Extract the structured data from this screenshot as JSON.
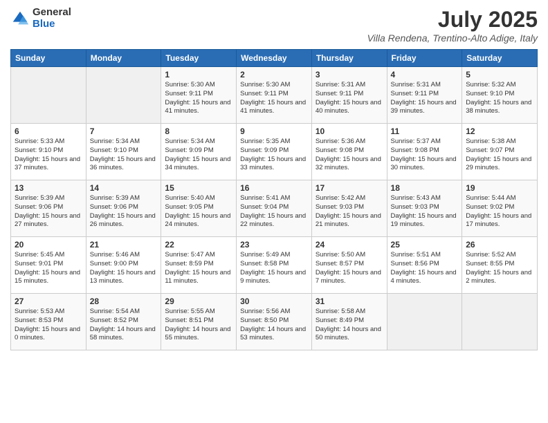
{
  "logo": {
    "general": "General",
    "blue": "Blue"
  },
  "title": {
    "month_year": "July 2025",
    "location": "Villa Rendena, Trentino-Alto Adige, Italy"
  },
  "weekdays": [
    "Sunday",
    "Monday",
    "Tuesday",
    "Wednesday",
    "Thursday",
    "Friday",
    "Saturday"
  ],
  "weeks": [
    [
      {
        "day": "",
        "info": ""
      },
      {
        "day": "",
        "info": ""
      },
      {
        "day": "1",
        "info": "Sunrise: 5:30 AM\nSunset: 9:11 PM\nDaylight: 15 hours and 41 minutes."
      },
      {
        "day": "2",
        "info": "Sunrise: 5:30 AM\nSunset: 9:11 PM\nDaylight: 15 hours and 41 minutes."
      },
      {
        "day": "3",
        "info": "Sunrise: 5:31 AM\nSunset: 9:11 PM\nDaylight: 15 hours and 40 minutes."
      },
      {
        "day": "4",
        "info": "Sunrise: 5:31 AM\nSunset: 9:11 PM\nDaylight: 15 hours and 39 minutes."
      },
      {
        "day": "5",
        "info": "Sunrise: 5:32 AM\nSunset: 9:10 PM\nDaylight: 15 hours and 38 minutes."
      }
    ],
    [
      {
        "day": "6",
        "info": "Sunrise: 5:33 AM\nSunset: 9:10 PM\nDaylight: 15 hours and 37 minutes."
      },
      {
        "day": "7",
        "info": "Sunrise: 5:34 AM\nSunset: 9:10 PM\nDaylight: 15 hours and 36 minutes."
      },
      {
        "day": "8",
        "info": "Sunrise: 5:34 AM\nSunset: 9:09 PM\nDaylight: 15 hours and 34 minutes."
      },
      {
        "day": "9",
        "info": "Sunrise: 5:35 AM\nSunset: 9:09 PM\nDaylight: 15 hours and 33 minutes."
      },
      {
        "day": "10",
        "info": "Sunrise: 5:36 AM\nSunset: 9:08 PM\nDaylight: 15 hours and 32 minutes."
      },
      {
        "day": "11",
        "info": "Sunrise: 5:37 AM\nSunset: 9:08 PM\nDaylight: 15 hours and 30 minutes."
      },
      {
        "day": "12",
        "info": "Sunrise: 5:38 AM\nSunset: 9:07 PM\nDaylight: 15 hours and 29 minutes."
      }
    ],
    [
      {
        "day": "13",
        "info": "Sunrise: 5:39 AM\nSunset: 9:06 PM\nDaylight: 15 hours and 27 minutes."
      },
      {
        "day": "14",
        "info": "Sunrise: 5:39 AM\nSunset: 9:06 PM\nDaylight: 15 hours and 26 minutes."
      },
      {
        "day": "15",
        "info": "Sunrise: 5:40 AM\nSunset: 9:05 PM\nDaylight: 15 hours and 24 minutes."
      },
      {
        "day": "16",
        "info": "Sunrise: 5:41 AM\nSunset: 9:04 PM\nDaylight: 15 hours and 22 minutes."
      },
      {
        "day": "17",
        "info": "Sunrise: 5:42 AM\nSunset: 9:03 PM\nDaylight: 15 hours and 21 minutes."
      },
      {
        "day": "18",
        "info": "Sunrise: 5:43 AM\nSunset: 9:03 PM\nDaylight: 15 hours and 19 minutes."
      },
      {
        "day": "19",
        "info": "Sunrise: 5:44 AM\nSunset: 9:02 PM\nDaylight: 15 hours and 17 minutes."
      }
    ],
    [
      {
        "day": "20",
        "info": "Sunrise: 5:45 AM\nSunset: 9:01 PM\nDaylight: 15 hours and 15 minutes."
      },
      {
        "day": "21",
        "info": "Sunrise: 5:46 AM\nSunset: 9:00 PM\nDaylight: 15 hours and 13 minutes."
      },
      {
        "day": "22",
        "info": "Sunrise: 5:47 AM\nSunset: 8:59 PM\nDaylight: 15 hours and 11 minutes."
      },
      {
        "day": "23",
        "info": "Sunrise: 5:49 AM\nSunset: 8:58 PM\nDaylight: 15 hours and 9 minutes."
      },
      {
        "day": "24",
        "info": "Sunrise: 5:50 AM\nSunset: 8:57 PM\nDaylight: 15 hours and 7 minutes."
      },
      {
        "day": "25",
        "info": "Sunrise: 5:51 AM\nSunset: 8:56 PM\nDaylight: 15 hours and 4 minutes."
      },
      {
        "day": "26",
        "info": "Sunrise: 5:52 AM\nSunset: 8:55 PM\nDaylight: 15 hours and 2 minutes."
      }
    ],
    [
      {
        "day": "27",
        "info": "Sunrise: 5:53 AM\nSunset: 8:53 PM\nDaylight: 15 hours and 0 minutes."
      },
      {
        "day": "28",
        "info": "Sunrise: 5:54 AM\nSunset: 8:52 PM\nDaylight: 14 hours and 58 minutes."
      },
      {
        "day": "29",
        "info": "Sunrise: 5:55 AM\nSunset: 8:51 PM\nDaylight: 14 hours and 55 minutes."
      },
      {
        "day": "30",
        "info": "Sunrise: 5:56 AM\nSunset: 8:50 PM\nDaylight: 14 hours and 53 minutes."
      },
      {
        "day": "31",
        "info": "Sunrise: 5:58 AM\nSunset: 8:49 PM\nDaylight: 14 hours and 50 minutes."
      },
      {
        "day": "",
        "info": ""
      },
      {
        "day": "",
        "info": ""
      }
    ]
  ]
}
